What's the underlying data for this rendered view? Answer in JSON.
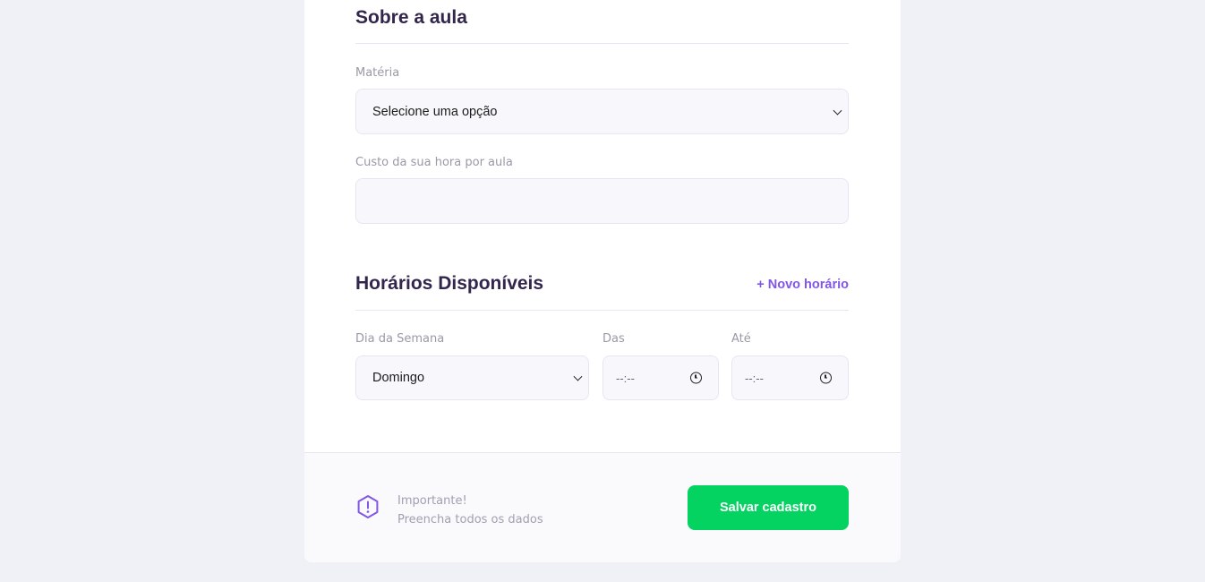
{
  "about": {
    "title": "Sobre a aula",
    "subject_label": "Matéria",
    "subject_value": "Selecione uma opção",
    "cost_label": "Custo da sua hora por aula",
    "cost_value": ""
  },
  "schedule": {
    "title": "Horários Disponíveis",
    "add_label": "+ Novo horário",
    "weekday_label": "Dia da Semana",
    "weekday_value": "Domingo",
    "from_label": "Das",
    "from_value": "--:--",
    "to_label": "Até",
    "to_value": "--:--"
  },
  "footer": {
    "warning_title": "Importante!",
    "warning_text": "Preencha todos os dados",
    "save_label": "Salvar cadastro"
  },
  "colors": {
    "accent": "#8257e5",
    "save_button": "#04d361",
    "title": "#32264d"
  }
}
